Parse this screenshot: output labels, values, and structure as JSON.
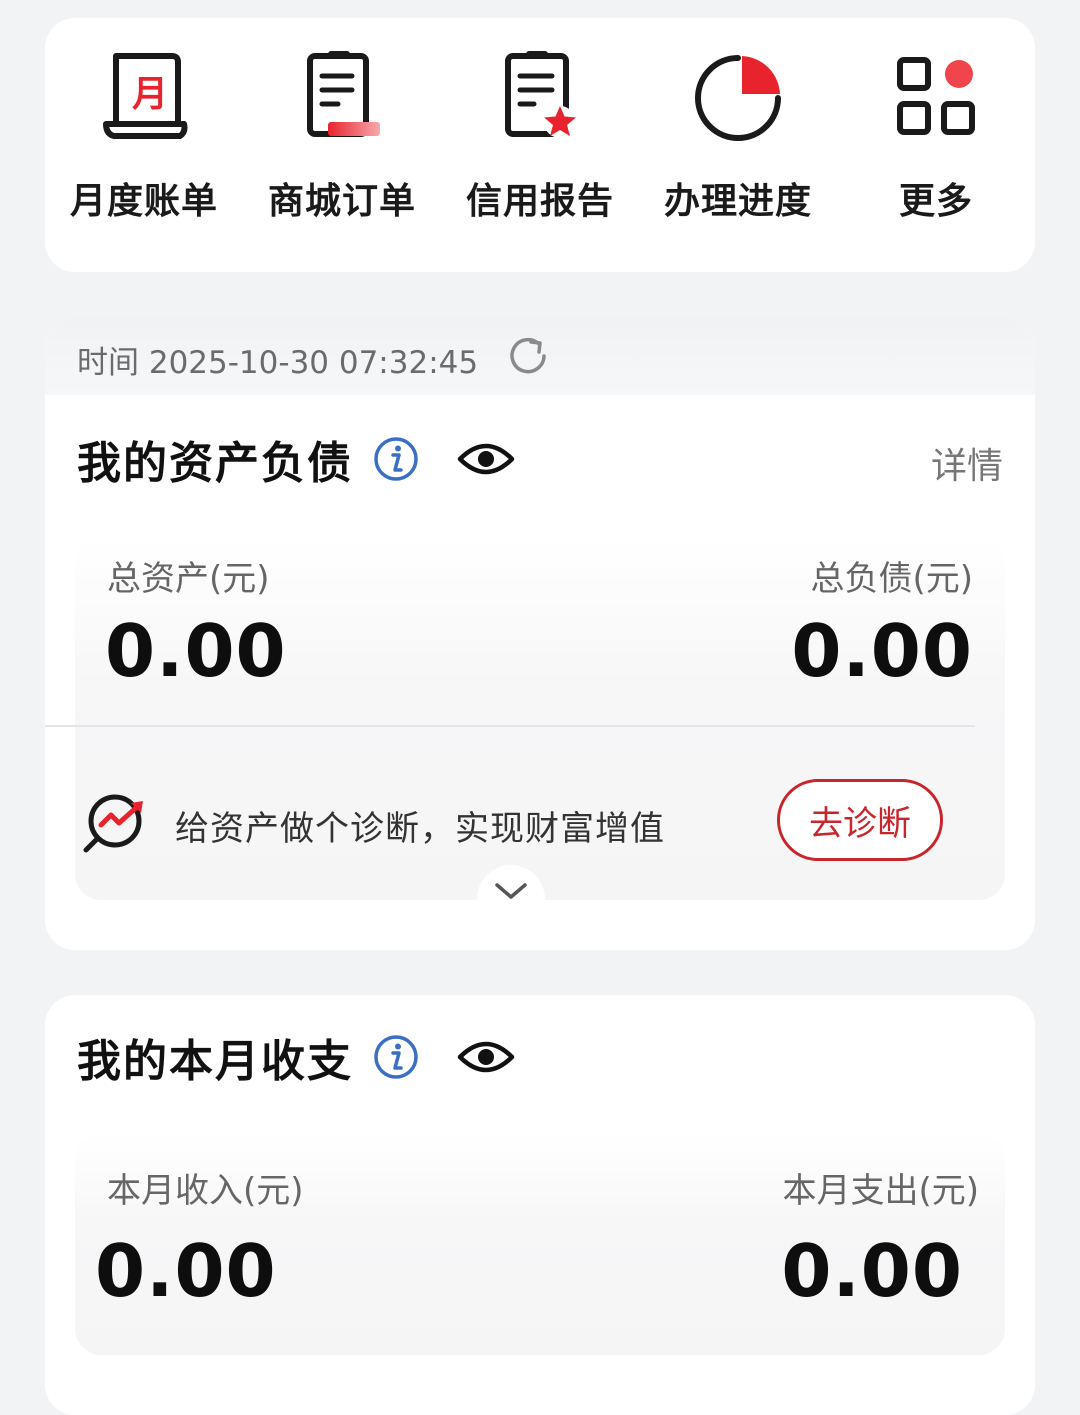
{
  "quick_actions": [
    {
      "label": "月度账单",
      "icon": "monthly-bill-icon"
    },
    {
      "label": "商城订单",
      "icon": "mall-order-icon"
    },
    {
      "label": "信用报告",
      "icon": "credit-report-icon"
    },
    {
      "label": "办理进度",
      "icon": "progress-pie-icon"
    },
    {
      "label": "更多",
      "icon": "more-grid-icon"
    }
  ],
  "monthly_icon_char": "月",
  "assets": {
    "time_text": "时间 2025-10-30 07:32:45",
    "title": "我的资产负债",
    "detail": "详情",
    "total_assets_label": "总资产(元)",
    "total_assets_value": "0.00",
    "total_debt_label": "总负债(元)",
    "total_debt_value": "0.00",
    "diagnose_text": "给资产做个诊断，实现财富增值",
    "diagnose_button": "去诊断"
  },
  "income": {
    "title": "我的本月收支",
    "income_label": "本月收入(元)",
    "income_value": "0.00",
    "expense_label": "本月支出(元)",
    "expense_value": "0.00"
  },
  "colors": {
    "accent_red": "#e8232d",
    "button_red": "#c8252c",
    "info_blue": "#3a6fc4"
  }
}
